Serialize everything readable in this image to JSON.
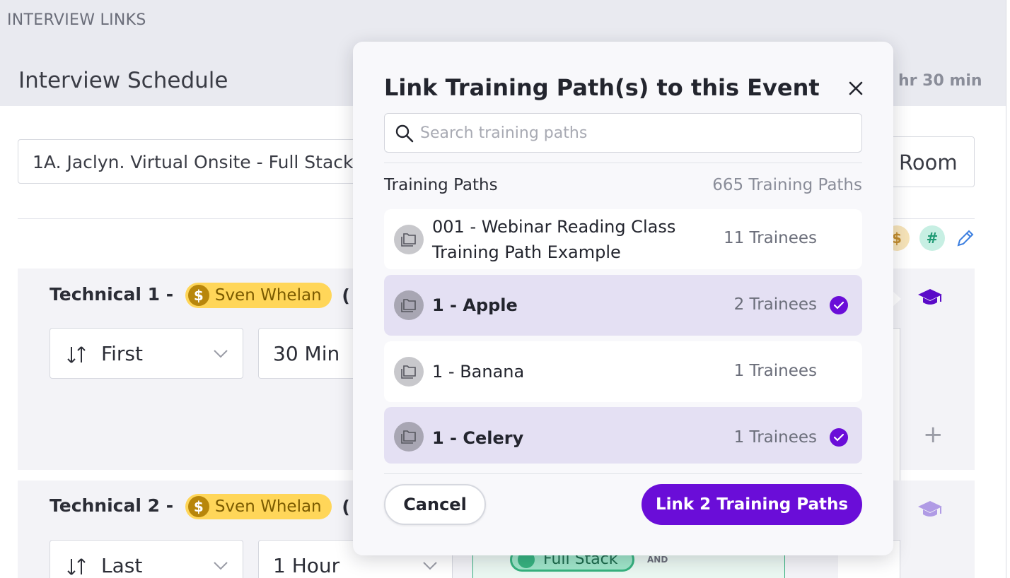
{
  "page": {
    "eyebrow": "INTERVIEW LINKS",
    "schedule_title": "Interview Schedule",
    "duration_partial": "hr 30 min",
    "event_name": "1A. Jaclyn. Virtual Onsite - Full Stack ...",
    "room_label": "Room",
    "tag_dollar": "$",
    "tag_hash": "#",
    "sections": [
      {
        "title": "Technical 1 -",
        "interviewer": "Sven Whelan",
        "paren": "(",
        "order": "First",
        "length": "30 Min"
      },
      {
        "title": "Technical 2 -",
        "interviewer": "Sven Whelan",
        "paren": "(",
        "order": "Last",
        "length": "1 Hour",
        "tag": "Full Stack",
        "and_label": "AND"
      }
    ],
    "plus": "+"
  },
  "modal": {
    "title": "Link Training Path(s) to this Event",
    "search_placeholder": "Search training paths",
    "list_label": "Training Paths",
    "list_count": "665 Training Paths",
    "items": [
      {
        "name": "001 - Webinar Reading Class Training Path Example",
        "trainees": "11 Trainees",
        "selected": false
      },
      {
        "name": "1 - Apple",
        "trainees": "2 Trainees",
        "selected": true
      },
      {
        "name": "1 - Banana",
        "trainees": "1 Trainees",
        "selected": false
      },
      {
        "name": "1 - Celery",
        "trainees": "1 Trainees",
        "selected": true
      }
    ],
    "cancel_label": "Cancel",
    "confirm_label": "Link 2 Training Paths"
  },
  "colors": {
    "accent": "#6a0dd8",
    "selected_row": "#e4e0f3",
    "interviewer_pill": "#ffd659",
    "tag_green": "#36b27f"
  },
  "icons": [
    "search-icon",
    "close-icon",
    "folder-icon",
    "check-icon",
    "sort-icon",
    "chevron-down-icon",
    "graduation-cap-icon",
    "pencil-icon",
    "dollar-icon",
    "hash-icon",
    "plus-icon"
  ]
}
